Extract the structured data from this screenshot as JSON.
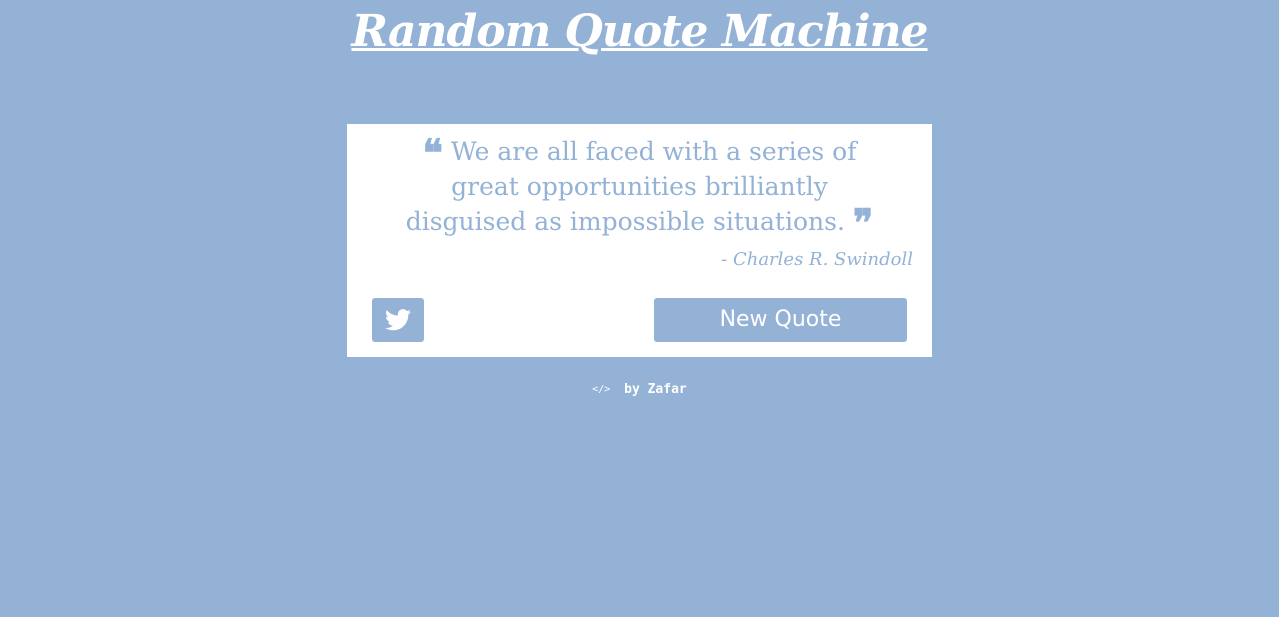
{
  "page": {
    "title": "Random Quote Machine",
    "background_color": "#93b2d6"
  },
  "quote": {
    "open_mark_icon": "quote-left-icon",
    "open_mark": "❝",
    "text": "We are all faced with a series of great opportunities brilliantly disguised as impossible situations.",
    "close_mark_icon": "quote-right-icon",
    "close_mark": "❞",
    "author": "- Charles R. Swindoll"
  },
  "actions": {
    "tweet_icon": "twitter-icon",
    "new_quote_label": "New Quote"
  },
  "footer": {
    "code_icon": "code-icon",
    "code_glyph": "</>",
    "text": "by Zafar"
  }
}
